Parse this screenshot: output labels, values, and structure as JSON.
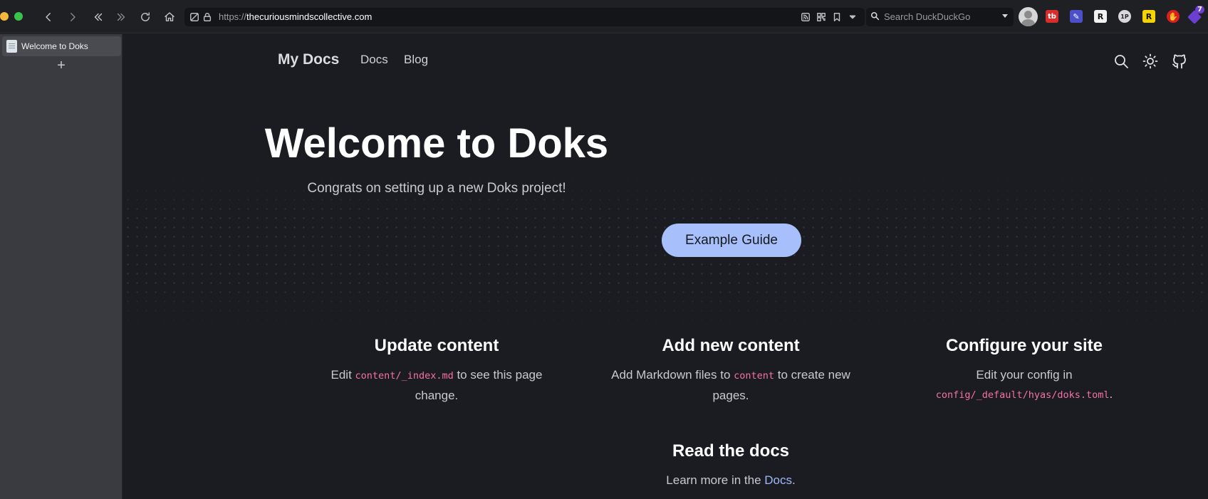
{
  "browser": {
    "url_scheme": "https://",
    "url_host": "thecuriousmindscollective.com",
    "search_placeholder": "Search DuckDuckGo",
    "extension_badge": "7",
    "extensions": [
      "tb",
      "R",
      "1P",
      "R"
    ]
  },
  "sidebar": {
    "tab_title": "Welcome to Doks",
    "add_label": "+"
  },
  "header": {
    "brand": "My Docs",
    "nav": [
      "Docs",
      "Blog"
    ]
  },
  "hero": {
    "title": "Welcome to Doks",
    "subtitle": "Congrats on setting up a new Doks project!",
    "button": "Example Guide"
  },
  "features": [
    {
      "title": "Update content",
      "text_pre": "Edit ",
      "code": "content/_index.md",
      "text_post": " to see this page change."
    },
    {
      "title": "Add new content",
      "text_pre": "Add Markdown files to ",
      "code": "content",
      "text_post": " to create new pages."
    },
    {
      "title": "Configure your site",
      "text_pre": "Edit your config in ",
      "code": "config/_default/hyas/doks.toml",
      "text_post": "."
    },
    {
      "title": "Read the docs",
      "text_pre": "Learn more in the ",
      "link": "Docs",
      "text_post": "."
    }
  ],
  "colors": {
    "background": "#1b1c21",
    "accent_button": "#a7c0fb",
    "code": "#f472a8",
    "link": "#9fb8f5"
  }
}
